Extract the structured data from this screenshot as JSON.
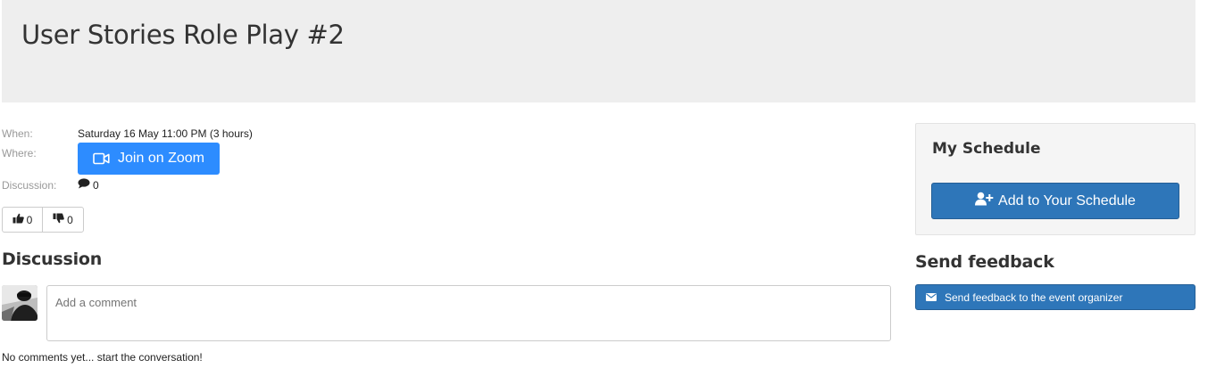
{
  "event": {
    "title": "User Stories Role Play #2"
  },
  "details": {
    "when_label": "When:",
    "when_value": "Saturday 16 May 11:00 PM (3 hours)",
    "where_label": "Where:",
    "join_button": "Join on Zoom",
    "discussion_label": "Discussion:",
    "discussion_count": "0"
  },
  "votes": {
    "up_count": "0",
    "down_count": "0"
  },
  "discussion": {
    "heading": "Discussion",
    "comment_placeholder": "Add a comment",
    "empty_text": "No comments yet... start the conversation!"
  },
  "schedule": {
    "heading": "My Schedule",
    "add_button": "Add to Your Schedule"
  },
  "feedback": {
    "heading": "Send feedback",
    "button": "Send feedback to the event organizer"
  },
  "colors": {
    "zoom_blue": "#2d8cff",
    "primary_blue": "#2e76b9",
    "banner_gray": "#eeeeee"
  },
  "icons": {
    "zoom": "video-camera-icon",
    "comment": "comment-bubble-icon",
    "upvote": "thumbs-up-icon",
    "downvote": "thumbs-down-icon",
    "add_schedule": "user-plus-icon",
    "feedback": "envelope-icon"
  }
}
